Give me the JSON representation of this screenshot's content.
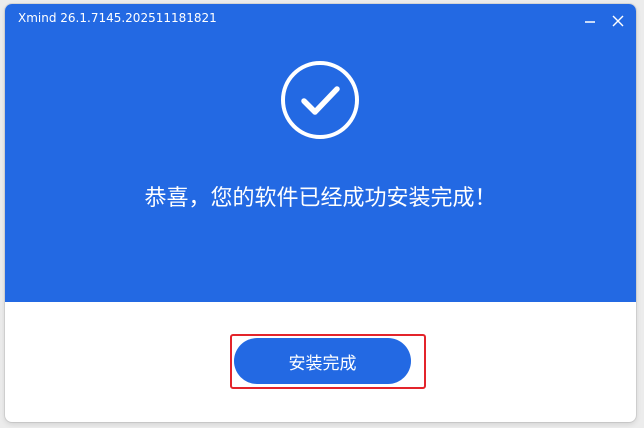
{
  "window": {
    "title": "Xmind 26.1.7145.202511181821"
  },
  "controls": {
    "minimize_icon": "minimize-icon",
    "close_icon": "close-icon"
  },
  "main": {
    "success_icon": "checkmark-circle-icon",
    "message": "恭喜，您的软件已经成功安装完成！"
  },
  "footer": {
    "finish_label": "安装完成"
  },
  "colors": {
    "accent": "#2369e3",
    "highlight": "#e3242b",
    "background": "#ffffff"
  }
}
